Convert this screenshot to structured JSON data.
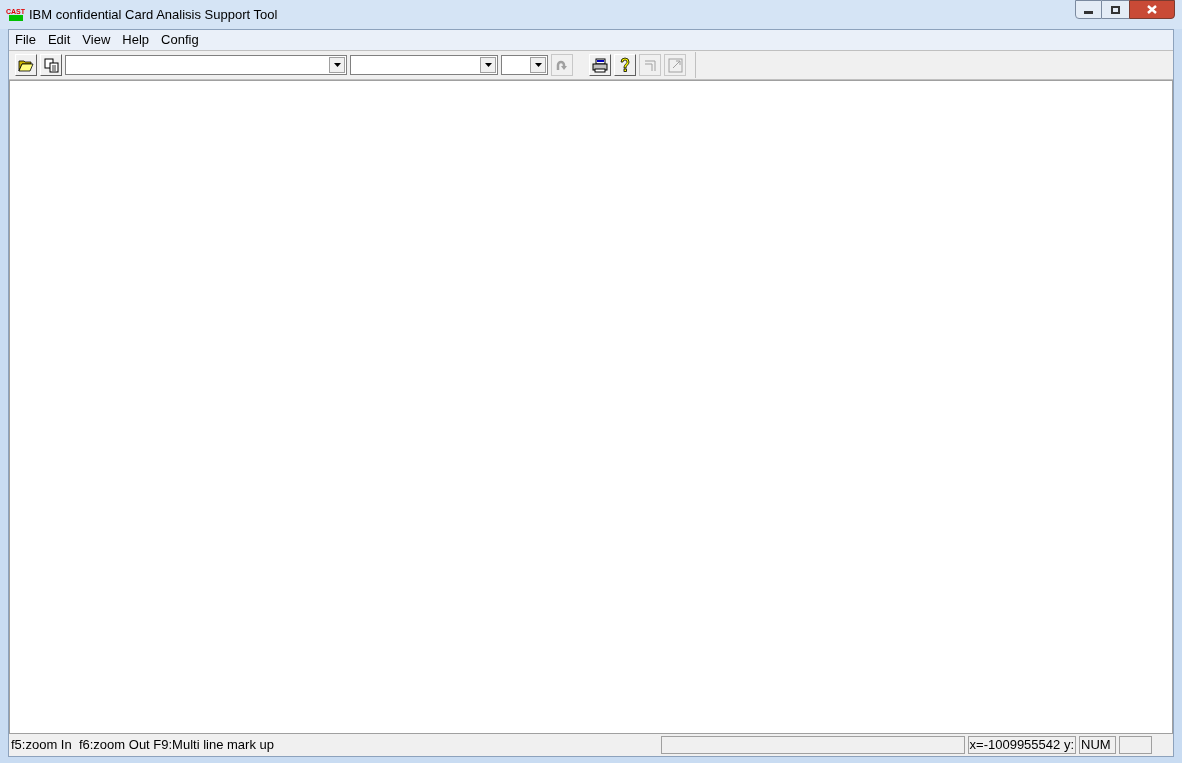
{
  "window": {
    "title": "IBM confidential Card Analisis Support Tool",
    "logo": "CAST"
  },
  "menu": [
    "File",
    "Edit",
    "View",
    "Help",
    "Config"
  ],
  "toolbar": [
    {
      "kind": "open",
      "disabled": false
    },
    {
      "kind": "copy",
      "disabled": false
    },
    {
      "kind": "combo"
    },
    {
      "kind": "combo"
    },
    {
      "kind": "combo"
    },
    {
      "kind": "redo",
      "disabled": true
    },
    {
      "kind": "spacer"
    },
    {
      "kind": "print",
      "disabled": false
    },
    {
      "kind": "help",
      "disabled": false
    },
    {
      "kind": "bracket",
      "disabled": true
    },
    {
      "kind": "resize",
      "disabled": true
    }
  ],
  "status_bar": {
    "hint": "f5:zoom In  f6:zoom Out F9:Multi line mark up",
    "coords": "x=-1009955542 y:",
    "num": "NUM"
  }
}
